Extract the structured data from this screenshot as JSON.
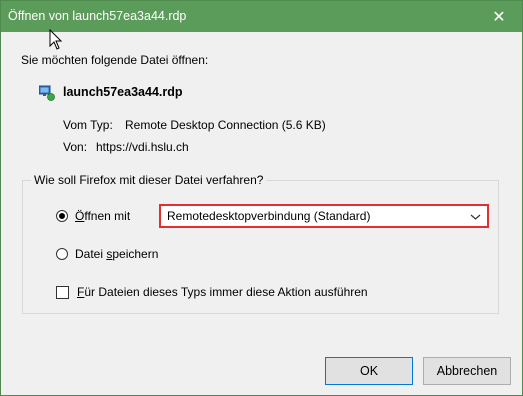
{
  "window": {
    "title": "Öffnen von launch57ea3a44.rdp",
    "close_glyph": "✕"
  },
  "dialog": {
    "intro": "Sie möchten folgende Datei öffnen:",
    "filename": "launch57ea3a44.rdp",
    "type_label": "Vom Typ:",
    "type_value": "Remote Desktop Connection (5.6 KB)",
    "from_label": "Von:",
    "from_value": "https://vdi.hslu.ch",
    "group_legend": "Wie soll Firefox mit dieser Datei verfahren?",
    "open_with_label_underline": "Ö",
    "open_with_label_rest": "ffnen mit",
    "open_with_selected": "Remotedesktopverbindung (Standard)",
    "save_label_pre": "Datei ",
    "save_label_underline": "s",
    "save_label_rest": "peichern",
    "remember_label_underline": "F",
    "remember_label_rest": "ür Dateien dieses Typs immer diese Aktion ausführen"
  },
  "buttons": {
    "ok": "OK",
    "cancel": "Abbrechen"
  },
  "colors": {
    "titlebar": "#5c9c5a",
    "select_highlight": "#e03030"
  }
}
